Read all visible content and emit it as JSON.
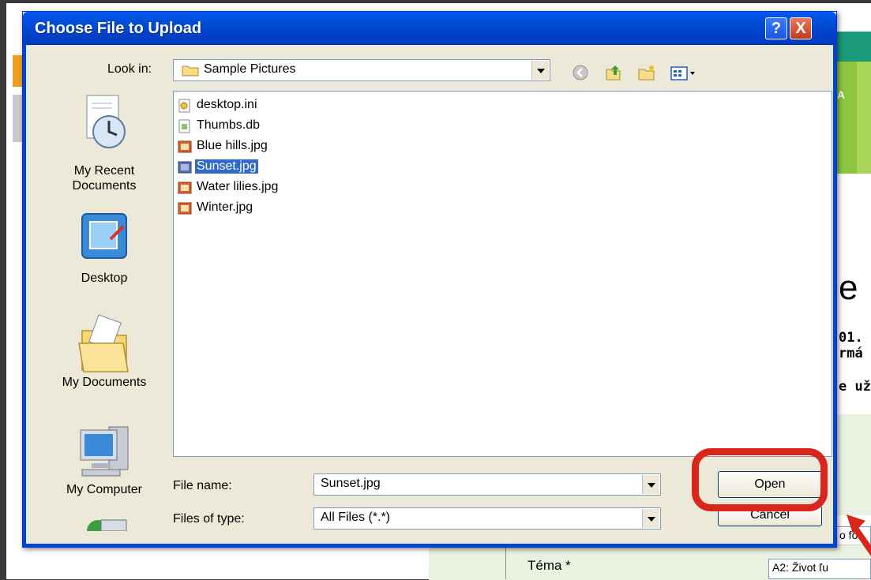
{
  "dialog": {
    "title": "Choose File to Upload",
    "help_label": "?",
    "close_label": "X",
    "look_in_label": "Look in:",
    "look_in_value": "Sample Pictures",
    "file_name_label": "File name:",
    "file_name_value": "Sunset.jpg",
    "files_of_type_label": "Files of type:",
    "files_of_type_value": "All Files (*.*)",
    "open_label": "Open",
    "cancel_label": "Cancel"
  },
  "places": [
    {
      "label1": "My Recent",
      "label2": "Documents",
      "icon": "recent-documents-icon"
    },
    {
      "label1": "Desktop",
      "label2": "",
      "icon": "desktop-icon"
    },
    {
      "label1": "My Documents",
      "label2": "",
      "icon": "my-documents-icon"
    },
    {
      "label1": "My Computer",
      "label2": "",
      "icon": "my-computer-icon"
    },
    {
      "label1": "",
      "label2": "",
      "icon": "network-icon"
    }
  ],
  "files": [
    {
      "name": "desktop.ini",
      "icon": "settings-file-icon",
      "selected": false
    },
    {
      "name": "Thumbs.db",
      "icon": "database-file-icon",
      "selected": false
    },
    {
      "name": "Blue hills.jpg",
      "icon": "image-file-icon",
      "selected": false
    },
    {
      "name": "Sunset.jpg",
      "icon": "image-file-icon",
      "selected": true
    },
    {
      "name": "Water lilies.jpg",
      "icon": "image-file-icon",
      "selected": false
    },
    {
      "name": "Winter.jpg",
      "icon": "image-file-icon",
      "selected": false
    }
  ],
  "background": {
    "heading_fragment": "e",
    "line1": "01.",
    "line2": "rmá",
    "line3": "e už",
    "field_label": "Téma *",
    "field_value": "A2: Život ľu",
    "partial_link": "o fot",
    "tab_fragment": "A"
  },
  "colors": {
    "title_bar": "#0047d0",
    "selection": "#316ac5",
    "highlight_ring": "#d9251c",
    "green_band": "#8cc63f"
  }
}
